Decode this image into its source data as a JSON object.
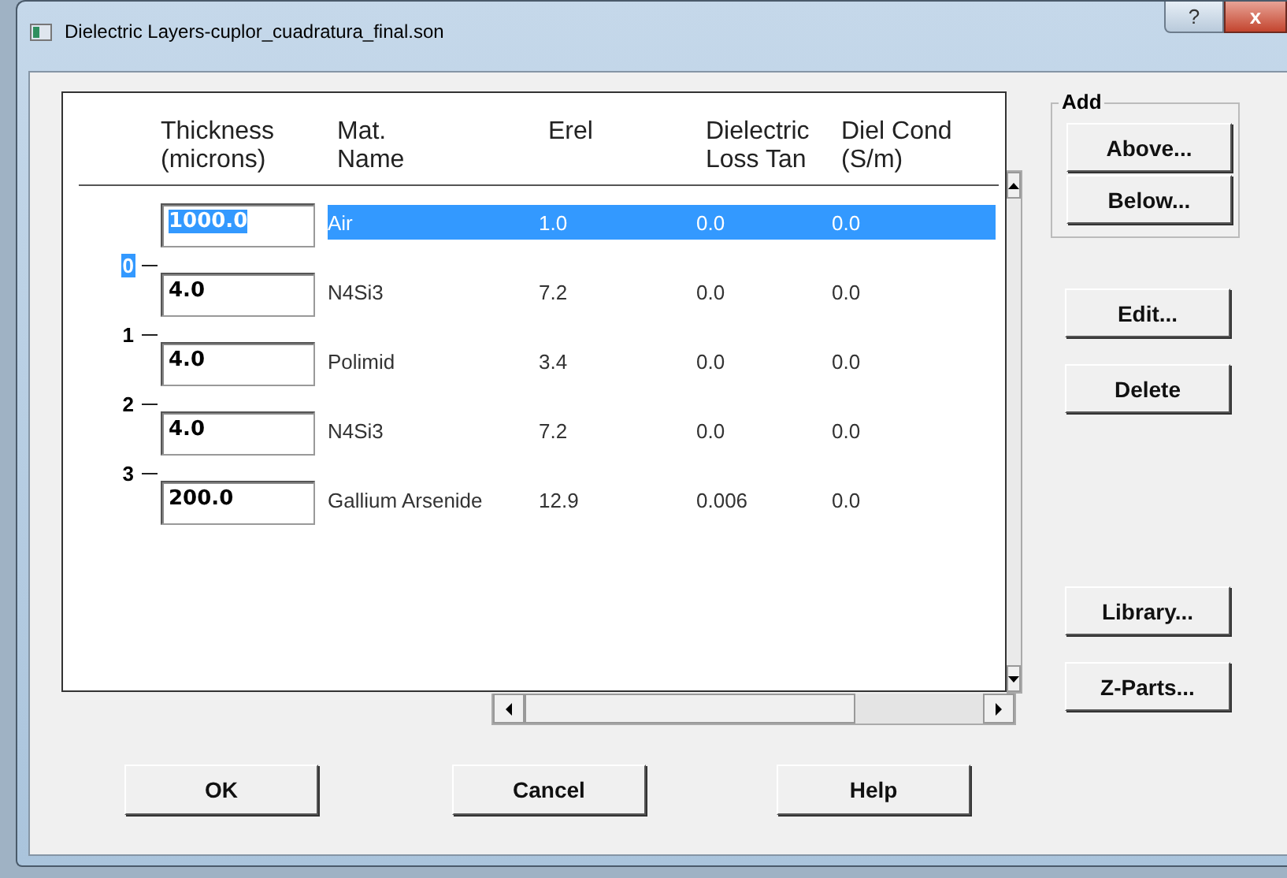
{
  "window": {
    "title": "Dielectric Layers-cuplor_cuadratura_final.son",
    "help_button": "?",
    "close_button": "x"
  },
  "table": {
    "columns": [
      {
        "line1": "Thickness",
        "line2": "(microns)"
      },
      {
        "line1": "Mat.",
        "line2": "Name"
      },
      {
        "line1": "Erel"
      },
      {
        "line1": "Dielectric",
        "line2": "Loss Tan"
      },
      {
        "line1": "Diel Cond",
        "line2": "(S/m)"
      }
    ],
    "layers": [
      {
        "thickness": "1000.0",
        "name": "Air",
        "erel": "1.0",
        "loss_tan": "0.0",
        "cond": "0.0",
        "selected": true,
        "interface": {
          "label": "0",
          "selected": true
        }
      },
      {
        "thickness": "4.0",
        "name": "N4Si3",
        "erel": "7.2",
        "loss_tan": "0.0",
        "cond": "0.0",
        "selected": false,
        "interface": {
          "label": "1",
          "selected": false
        }
      },
      {
        "thickness": "4.0",
        "name": "Polimid",
        "erel": "3.4",
        "loss_tan": "0.0",
        "cond": "0.0",
        "selected": false,
        "interface": {
          "label": "2",
          "selected": false
        }
      },
      {
        "thickness": "4.0",
        "name": "N4Si3",
        "erel": "7.2",
        "loss_tan": "0.0",
        "cond": "0.0",
        "selected": false,
        "interface": {
          "label": "3",
          "selected": false
        }
      },
      {
        "thickness": "200.0",
        "name": "Gallium Arsenide",
        "erel": "12.9",
        "loss_tan": "0.006",
        "cond": "0.0",
        "selected": false
      }
    ]
  },
  "add_group": {
    "title": "Add",
    "buttons": [
      "Above...",
      "Below..."
    ]
  },
  "side_buttons": [
    "Edit...",
    "Delete"
  ],
  "lower_side_buttons": [
    "Library...",
    "Z-Parts..."
  ],
  "buttons": [
    "OK",
    "Cancel",
    "Help"
  ]
}
